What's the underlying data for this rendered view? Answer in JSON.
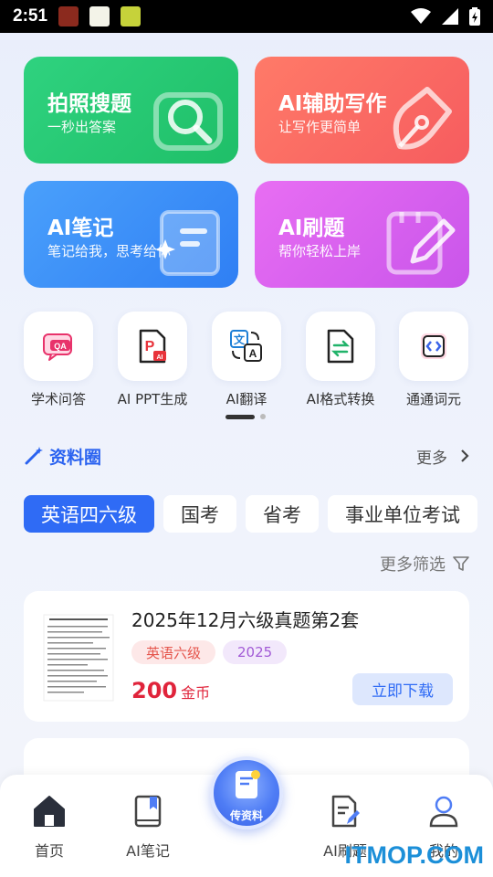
{
  "status_bar": {
    "time": "2:51"
  },
  "feature_cards": [
    {
      "title": "拍照搜题",
      "subtitle": "一秒出答案",
      "icon": "camera-search-icon",
      "color": "#22c771"
    },
    {
      "title": "AI辅助写作",
      "subtitle": "让写作更简单",
      "icon": "pen-nib-icon",
      "color": "#fa6b63"
    },
    {
      "title": "AI笔记",
      "subtitle": "笔记给我，思考给你",
      "icon": "notebook-icon",
      "color": "#3e8df7"
    },
    {
      "title": "AI刷题",
      "subtitle": "帮你轻松上岸",
      "icon": "pencil-paper-icon",
      "color": "#d864ee"
    }
  ],
  "tools": [
    {
      "label": "学术问答",
      "icon": "qa-bubble-icon"
    },
    {
      "label": "AI PPT生成",
      "icon": "ppt-file-icon"
    },
    {
      "label": "AI翻译",
      "icon": "translate-icon"
    },
    {
      "label": "AI格式转换",
      "icon": "file-convert-icon"
    },
    {
      "label": "通通词元",
      "icon": "code-bracket-icon"
    }
  ],
  "section": {
    "title": "资料圈",
    "more": "更多",
    "icon": "magic-wand-icon"
  },
  "tabs": [
    "英语四六级",
    "国考",
    "省考",
    "事业单位考试"
  ],
  "filter": {
    "label": "更多筛选",
    "icon": "funnel-icon"
  },
  "items": [
    {
      "title": "2025年12月六级真题第2套",
      "tags": [
        "英语六级",
        "2025"
      ],
      "price": "200",
      "price_unit": "金币",
      "action": "立即下载"
    }
  ],
  "fab": {
    "label": "传资料",
    "icon": "upload-doc-icon"
  },
  "bottom_nav": [
    {
      "label": "首页",
      "icon": "home-icon",
      "active": true
    },
    {
      "label": "AI笔记",
      "icon": "book-bookmark-icon",
      "active": false
    },
    {
      "label": "AI刷题",
      "icon": "doc-edit-icon",
      "active": false
    },
    {
      "label": "我的",
      "icon": "user-icon",
      "active": false
    }
  ],
  "watermark": "ITMOP.COM",
  "colors": {
    "primary": "#2f6bf5",
    "price": "#e0243b"
  }
}
